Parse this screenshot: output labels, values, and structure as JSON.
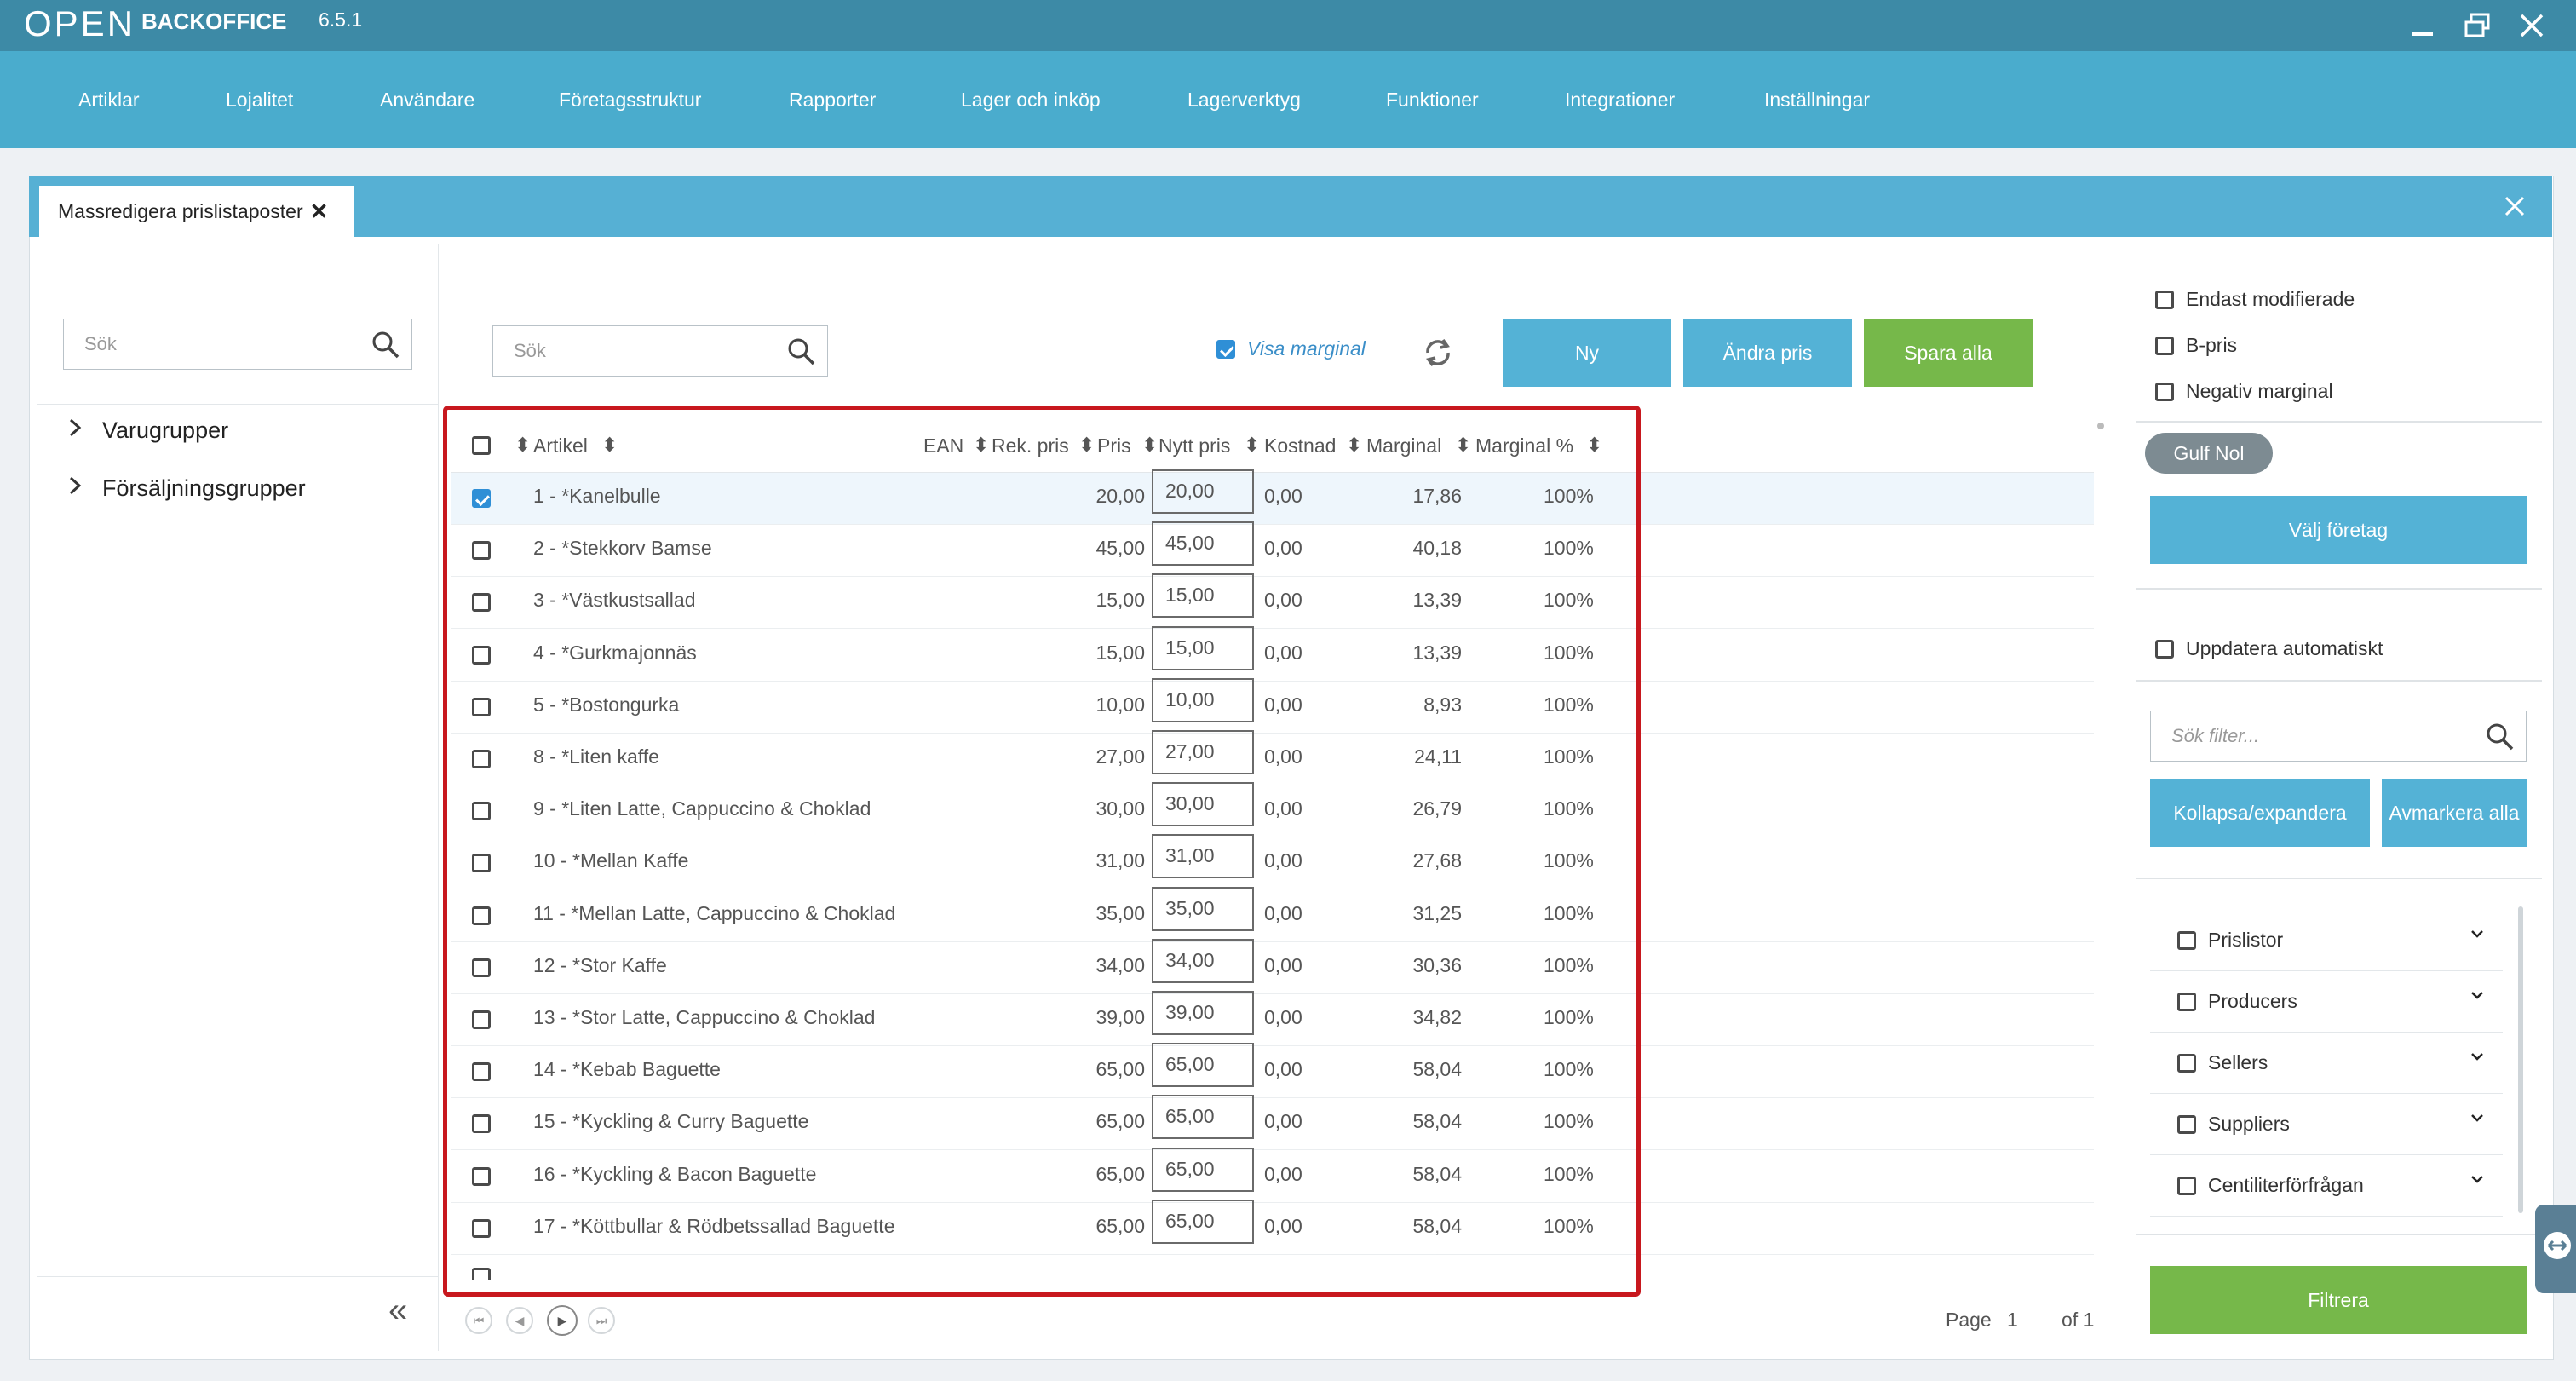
{
  "app": {
    "logo": "OPEN",
    "title": "BACKOFFICE",
    "version": "6.5.1"
  },
  "menu": [
    "Artiklar",
    "Lojalitet",
    "Användare",
    "Företagsstruktur",
    "Rapporter",
    "Lager och inköp",
    "Lagerverktyg",
    "Funktioner",
    "Integrationer",
    "Inställningar"
  ],
  "tab": {
    "label": "Massredigera prislistaposter"
  },
  "left": {
    "search_placeholder": "Sök",
    "tree": [
      "Varugrupper",
      "Försäljningsgrupper"
    ]
  },
  "toolbar": {
    "search_placeholder": "Sök",
    "show_margin_label": "Visa marginal",
    "new_label": "Ny",
    "change_price_label": "Ändra pris",
    "save_all_label": "Spara alla"
  },
  "table": {
    "headers": {
      "artikel": "Artikel",
      "ean": "EAN",
      "rek_pris": "Rek. pris",
      "pris": "Pris",
      "nytt_pris": "Nytt pris",
      "kostnad": "Kostnad",
      "marginal": "Marginal",
      "marginal_pct": "Marginal %"
    },
    "rows": [
      {
        "artikel": "1 - *Kanelbulle",
        "pris": "20,00",
        "nytt": "20,00",
        "kostnad": "0,00",
        "marginal": "17,86",
        "pct": "100%",
        "checked": true
      },
      {
        "artikel": "2 - *Stekkorv Bamse",
        "pris": "45,00",
        "nytt": "45,00",
        "kostnad": "0,00",
        "marginal": "40,18",
        "pct": "100%",
        "checked": false
      },
      {
        "artikel": "3 - *Västkustsallad",
        "pris": "15,00",
        "nytt": "15,00",
        "kostnad": "0,00",
        "marginal": "13,39",
        "pct": "100%",
        "checked": false
      },
      {
        "artikel": "4 - *Gurkmajonnäs",
        "pris": "15,00",
        "nytt": "15,00",
        "kostnad": "0,00",
        "marginal": "13,39",
        "pct": "100%",
        "checked": false
      },
      {
        "artikel": "5 - *Bostongurka",
        "pris": "10,00",
        "nytt": "10,00",
        "kostnad": "0,00",
        "marginal": "8,93",
        "pct": "100%",
        "checked": false
      },
      {
        "artikel": "8 - *Liten kaffe",
        "pris": "27,00",
        "nytt": "27,00",
        "kostnad": "0,00",
        "marginal": "24,11",
        "pct": "100%",
        "checked": false
      },
      {
        "artikel": "9 - *Liten Latte, Cappuccino & Choklad",
        "pris": "30,00",
        "nytt": "30,00",
        "kostnad": "0,00",
        "marginal": "26,79",
        "pct": "100%",
        "checked": false
      },
      {
        "artikel": "10 - *Mellan Kaffe",
        "pris": "31,00",
        "nytt": "31,00",
        "kostnad": "0,00",
        "marginal": "27,68",
        "pct": "100%",
        "checked": false
      },
      {
        "artikel": "11 - *Mellan Latte, Cappuccino & Choklad",
        "pris": "35,00",
        "nytt": "35,00",
        "kostnad": "0,00",
        "marginal": "31,25",
        "pct": "100%",
        "checked": false
      },
      {
        "artikel": "12 - *Stor Kaffe",
        "pris": "34,00",
        "nytt": "34,00",
        "kostnad": "0,00",
        "marginal": "30,36",
        "pct": "100%",
        "checked": false
      },
      {
        "artikel": "13 - *Stor Latte, Cappuccino & Choklad",
        "pris": "39,00",
        "nytt": "39,00",
        "kostnad": "0,00",
        "marginal": "34,82",
        "pct": "100%",
        "checked": false
      },
      {
        "artikel": "14 - *Kebab Baguette",
        "pris": "65,00",
        "nytt": "65,00",
        "kostnad": "0,00",
        "marginal": "58,04",
        "pct": "100%",
        "checked": false
      },
      {
        "artikel": "15 - *Kyckling & Curry Baguette",
        "pris": "65,00",
        "nytt": "65,00",
        "kostnad": "0,00",
        "marginal": "58,04",
        "pct": "100%",
        "checked": false
      },
      {
        "artikel": "16 - *Kyckling & Bacon Baguette",
        "pris": "65,00",
        "nytt": "65,00",
        "kostnad": "0,00",
        "marginal": "58,04",
        "pct": "100%",
        "checked": false
      },
      {
        "artikel": "17 - *Köttbullar & Rödbetssallad Baguette",
        "pris": "65,00",
        "nytt": "65,00",
        "kostnad": "0,00",
        "marginal": "58,04",
        "pct": "100%",
        "checked": false
      }
    ]
  },
  "pager": {
    "page_label": "Page",
    "page": "1",
    "of_label": "of 1"
  },
  "right": {
    "only_modified": "Endast modifierade",
    "b_price": "B-pris",
    "negative_margin": "Negativ marginal",
    "company_chip": "Gulf Nol",
    "choose_company": "Välj företag",
    "auto_update": "Uppdatera automatiskt",
    "filter_search_placeholder": "Sök filter...",
    "collapse_expand": "Kollapsa/expandera",
    "deselect_all": "Avmarkera alla",
    "filters": [
      "Prislistor",
      "Producers",
      "Sellers",
      "Suppliers",
      "Centiliterförfrågan"
    ],
    "filter_button": "Filtrera"
  },
  "colors": {
    "titlebar": "#3d8aa6",
    "menubar": "#4aaccd",
    "accent_blue": "#54b2d6",
    "accent_green": "#76b84a",
    "highlight_red": "#c8181e"
  }
}
